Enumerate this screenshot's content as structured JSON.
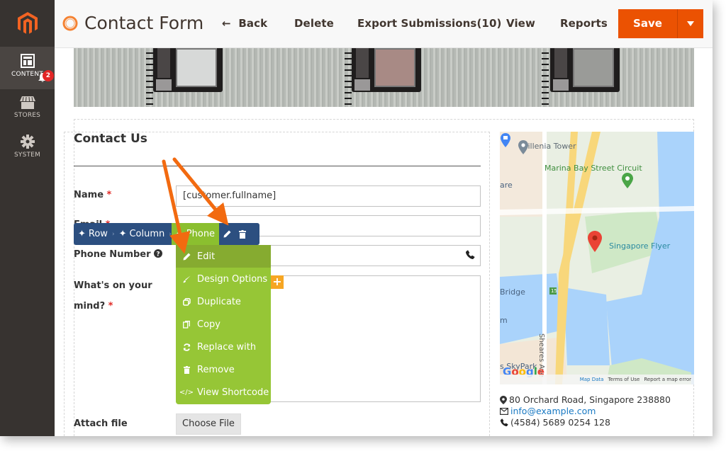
{
  "sidebar": {
    "items": [
      {
        "label": "CONTENT",
        "icon": "layout-icon",
        "active": true,
        "badge": "2"
      },
      {
        "label": "STORES",
        "icon": "store-icon"
      },
      {
        "label": "SYSTEM",
        "icon": "gear-icon"
      }
    ]
  },
  "header": {
    "title": "Contact Form",
    "back_label": "Back",
    "delete_label": "Delete",
    "export_label": "Export Submissions(10)",
    "view_label": "View",
    "reports_label": "Reports",
    "save_label": "Save"
  },
  "form": {
    "heading": "Contact Us",
    "fields": {
      "name": {
        "label": "Name",
        "required": "*",
        "value": "[customer.fullname]"
      },
      "email": {
        "label": "Email",
        "required": "*",
        "value": ""
      },
      "phone": {
        "label": "Phone Number",
        "value": ""
      },
      "message": {
        "label_line1": "What's on your",
        "label_line2": "mind?",
        "required": "*",
        "value": ""
      },
      "attach": {
        "label": "Attach file",
        "button": "Choose File"
      }
    }
  },
  "toolbar": {
    "breadcrumbs": [
      "Row",
      "Column",
      "Phone"
    ]
  },
  "context_menu": {
    "items": [
      "Edit",
      "Design Options",
      "Duplicate",
      "Copy",
      "Replace with",
      "Remove",
      "View Shortcode"
    ]
  },
  "map": {
    "labels": {
      "millenia": "Millenia Tower",
      "marina": "Marina Bay Street Circuit",
      "flyer": "Singapore Flyer",
      "bridge": "Bridge",
      "sheares": "Sheares Ave",
      "skypark": "s SkyPark",
      "are": "are",
      "route": "15",
      "m": "m"
    },
    "google": "Google",
    "footer": [
      "Map Data",
      "Terms of Use",
      "Report a map error"
    ]
  },
  "contact_info": {
    "address": "80 Orchard Road, Singapore 238880",
    "email": "info@example.com",
    "phone": "(4584) 5689 0254 128"
  },
  "colors": {
    "accent": "#eb5202",
    "sidebar": "#373330",
    "toolbar": "#2c4f80",
    "menu": "#96c636",
    "arrow": "#f26a10"
  }
}
